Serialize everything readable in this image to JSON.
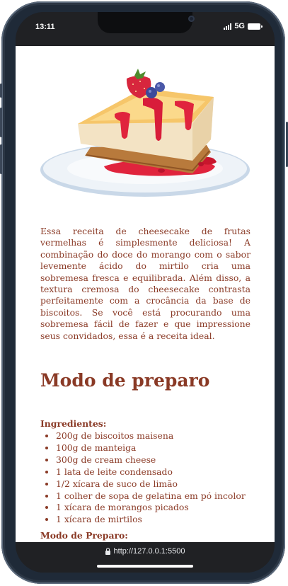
{
  "status_bar": {
    "time": "13:11",
    "network": "5G",
    "icons": [
      "signal-icon",
      "battery-icon"
    ]
  },
  "hero_image": {
    "icon": "cheesecake-slice-image"
  },
  "intro": "Essa receita de cheesecake de frutas vermelhas é simplesmente deliciosa! A combinação do doce do morango com o sabor levemente ácido do mirtilo cria uma sobremesa fresca e equilibrada. Além disso, a textura cremosa do cheesecake contrasta perfeitamente com a crocância da base de biscoitos. Se você está procurando uma sobremesa fácil de fazer e que impressione seus convidados, essa é a receita ideal.",
  "section_title": "Modo de preparo",
  "ingredients": {
    "heading": "Ingredientes:",
    "items": [
      "200g de biscoitos maisena",
      "100g de manteiga",
      "300g de cream cheese",
      "1 lata de leite condensado",
      "1/2 xícara de suco de limão",
      "1 colher de sopa de gelatina em pó incolor",
      "1 xícara de morangos picados",
      "1 xícara de mirtilos"
    ]
  },
  "prep_heading": "Modo de Preparo:",
  "browser": {
    "url": "http://127.0.0.1:5500"
  },
  "colors": {
    "text": "#8a3a26",
    "frame": "#1f2a38",
    "browser_bar": "#202124"
  }
}
